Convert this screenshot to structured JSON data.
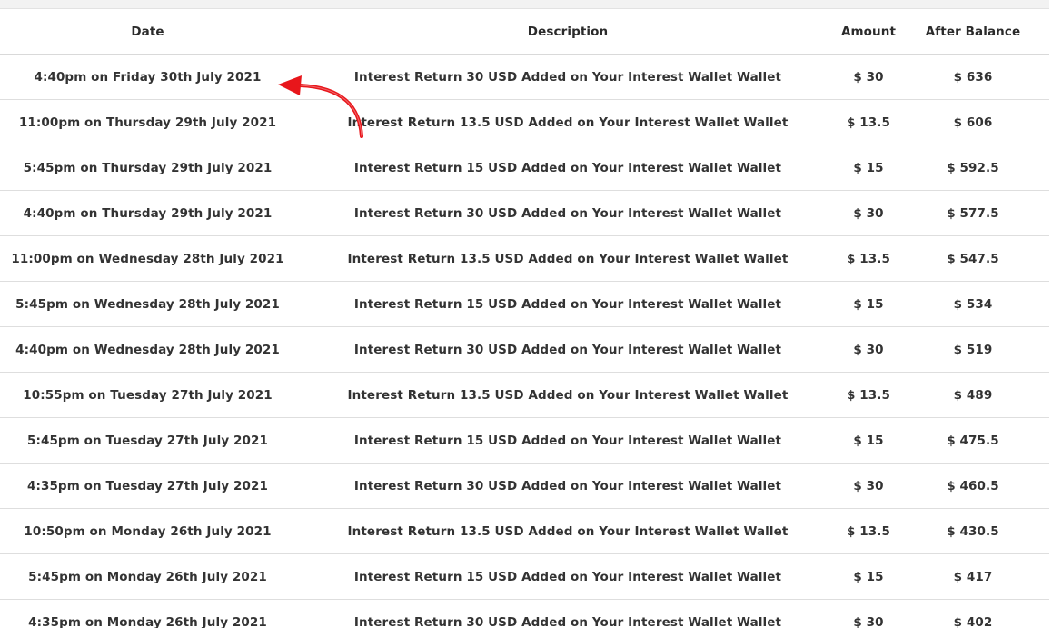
{
  "table": {
    "headers": {
      "date": "Date",
      "description": "Description",
      "amount": "Amount",
      "after_balance": "After Balance"
    },
    "rows": [
      {
        "date": "4:40pm on Friday 30th July 2021",
        "description": "Interest Return 30 USD Added on Your Interest Wallet Wallet",
        "amount": "$ 30",
        "after_balance": "$ 636"
      },
      {
        "date": "11:00pm on Thursday 29th July 2021",
        "description": "Interest Return 13.5 USD Added on Your Interest Wallet Wallet",
        "amount": "$ 13.5",
        "after_balance": "$ 606"
      },
      {
        "date": "5:45pm on Thursday 29th July 2021",
        "description": "Interest Return 15 USD Added on Your Interest Wallet Wallet",
        "amount": "$ 15",
        "after_balance": "$ 592.5"
      },
      {
        "date": "4:40pm on Thursday 29th July 2021",
        "description": "Interest Return 30 USD Added on Your Interest Wallet Wallet",
        "amount": "$ 30",
        "after_balance": "$ 577.5"
      },
      {
        "date": "11:00pm on Wednesday 28th July 2021",
        "description": "Interest Return 13.5 USD Added on Your Interest Wallet Wallet",
        "amount": "$ 13.5",
        "after_balance": "$ 547.5"
      },
      {
        "date": "5:45pm on Wednesday 28th July 2021",
        "description": "Interest Return 15 USD Added on Your Interest Wallet Wallet",
        "amount": "$ 15",
        "after_balance": "$ 534"
      },
      {
        "date": "4:40pm on Wednesday 28th July 2021",
        "description": "Interest Return 30 USD Added on Your Interest Wallet Wallet",
        "amount": "$ 30",
        "after_balance": "$ 519"
      },
      {
        "date": "10:55pm on Tuesday 27th July 2021",
        "description": "Interest Return 13.5 USD Added on Your Interest Wallet Wallet",
        "amount": "$ 13.5",
        "after_balance": "$ 489"
      },
      {
        "date": "5:45pm on Tuesday 27th July 2021",
        "description": "Interest Return 15 USD Added on Your Interest Wallet Wallet",
        "amount": "$ 15",
        "after_balance": "$ 475.5"
      },
      {
        "date": "4:35pm on Tuesday 27th July 2021",
        "description": "Interest Return 30 USD Added on Your Interest Wallet Wallet",
        "amount": "$ 30",
        "after_balance": "$ 460.5"
      },
      {
        "date": "10:50pm on Monday 26th July 2021",
        "description": "Interest Return 13.5 USD Added on Your Interest Wallet Wallet",
        "amount": "$ 13.5",
        "after_balance": "$ 430.5"
      },
      {
        "date": "5:45pm on Monday 26th July 2021",
        "description": "Interest Return 15 USD Added on Your Interest Wallet Wallet",
        "amount": "$ 15",
        "after_balance": "$ 417"
      },
      {
        "date": "4:35pm on Monday 26th July 2021",
        "description": "Interest Return 30 USD Added on Your Interest Wallet Wallet",
        "amount": "$ 30",
        "after_balance": "$ 402"
      }
    ]
  },
  "annotation": {
    "icon": "red-curved-arrow-icon",
    "color": "#e8161b"
  }
}
